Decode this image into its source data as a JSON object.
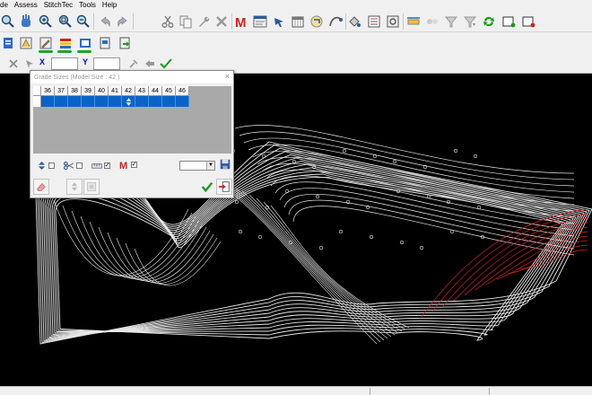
{
  "menu": {
    "items": [
      "de",
      "Assess",
      "StitchTec",
      "Tools",
      "Help"
    ]
  },
  "toolbar": {
    "x_label": "X",
    "y_label": "Y",
    "x_value": "",
    "y_value": ""
  },
  "dialog": {
    "title": "Grade Sizes (Model Size : 42 )",
    "close_glyph": "×",
    "sizes": [
      "36",
      "37",
      "38",
      "39",
      "40",
      "41",
      "42",
      "43",
      "44",
      "45",
      "46"
    ],
    "model_size_index": 6,
    "selected_size_value": "",
    "checkbox_states": {
      "grade_arrows": false,
      "scissors": false,
      "ruler_checked": true,
      "m_checked": true
    }
  },
  "colors": {
    "accent": "#0a64c8",
    "canvas": "#000000",
    "drawing_lines": "#e8e8e8",
    "red_highlight": "#e02020",
    "green_check": "#1a9a1a",
    "m_red": "#d42020"
  }
}
